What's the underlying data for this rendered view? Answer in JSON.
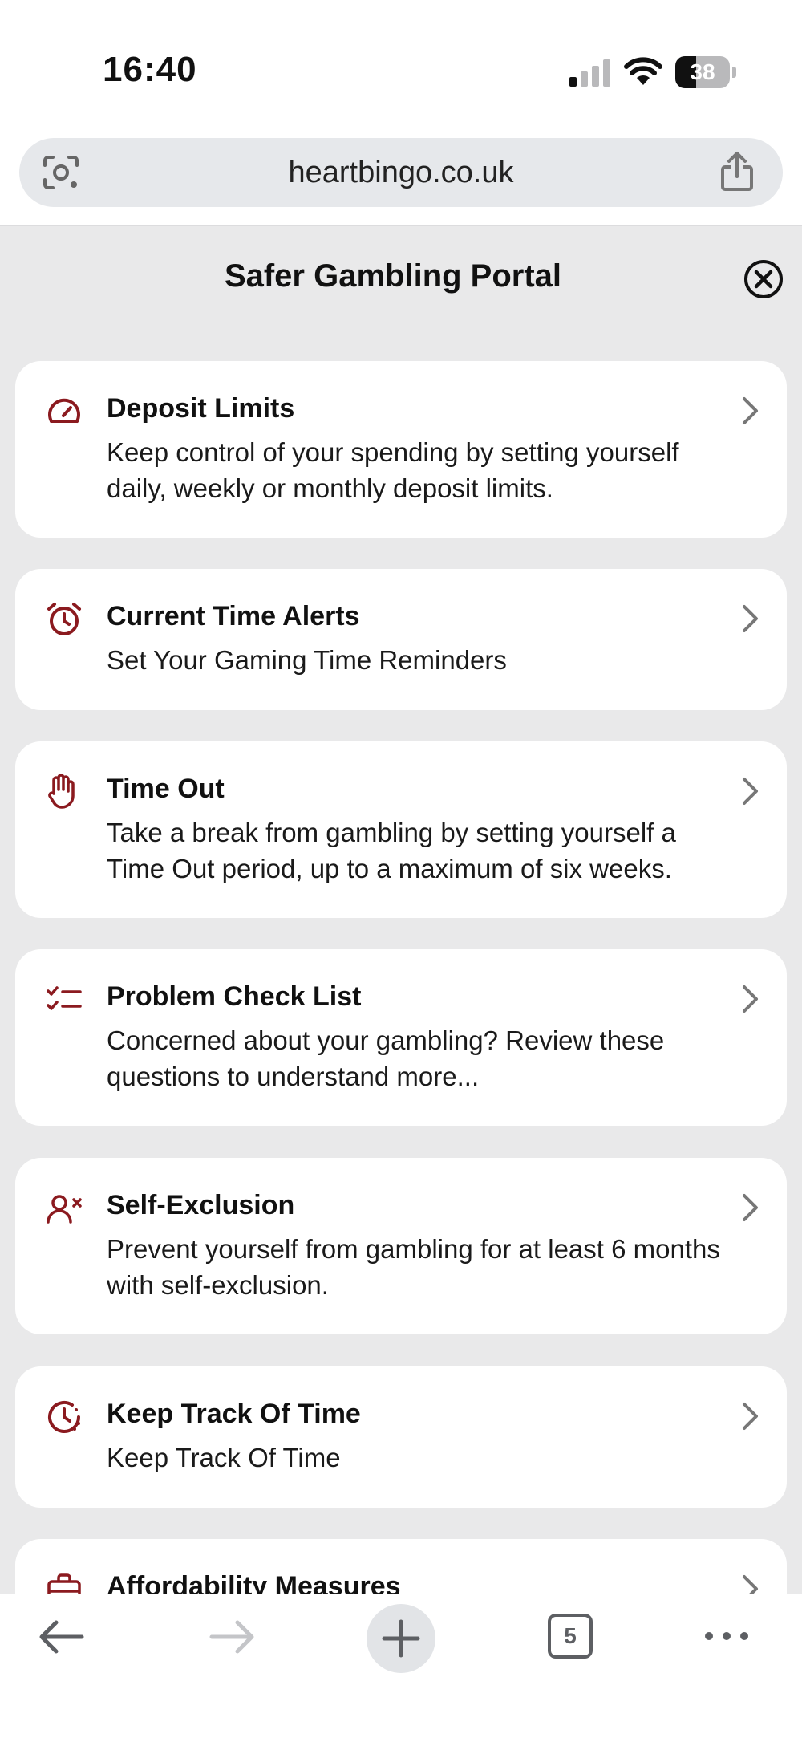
{
  "status_bar": {
    "time": "16:40",
    "battery_percent": "38",
    "battery_level": 0.38,
    "icons": [
      "signal-icon",
      "wifi-icon",
      "battery-icon"
    ]
  },
  "browser": {
    "url": "heartbingo.co.uk",
    "left_icon": "lens-icon",
    "right_icon": "share-icon"
  },
  "portal": {
    "title": "Safer Gambling Portal",
    "close_icon": "close-circle-icon"
  },
  "accent_color": "#8b1a1f",
  "cards": [
    {
      "icon": "gauge-icon",
      "title": "Deposit Limits",
      "desc": "Keep control of your spending by setting yourself daily, weekly or monthly deposit limits."
    },
    {
      "icon": "alarm-clock-icon",
      "title": "Current Time Alerts",
      "desc": "Set Your Gaming Time Reminders"
    },
    {
      "icon": "hand-icon",
      "title": "Time Out",
      "desc": "Take a break from gambling by setting yourself a Time Out period, up to a maximum of six weeks."
    },
    {
      "icon": "checklist-icon",
      "title": "Problem Check List",
      "desc": "Concerned about your gambling? Review these questions to understand more..."
    },
    {
      "icon": "user-x-icon",
      "title": "Self-Exclusion",
      "desc": "Prevent yourself from gambling for at least 6 months with self-exclusion."
    },
    {
      "icon": "clock-icon",
      "title": "Keep Track Of Time",
      "desc": "Keep Track Of Time"
    },
    {
      "icon": "briefcase-icon",
      "title": "Affordability Measures",
      "desc": ""
    }
  ],
  "toolbar": {
    "tab_count": "5",
    "icons": [
      "back-arrow-icon",
      "forward-arrow-icon",
      "plus-icon",
      "tabs-icon",
      "more-icon"
    ]
  }
}
